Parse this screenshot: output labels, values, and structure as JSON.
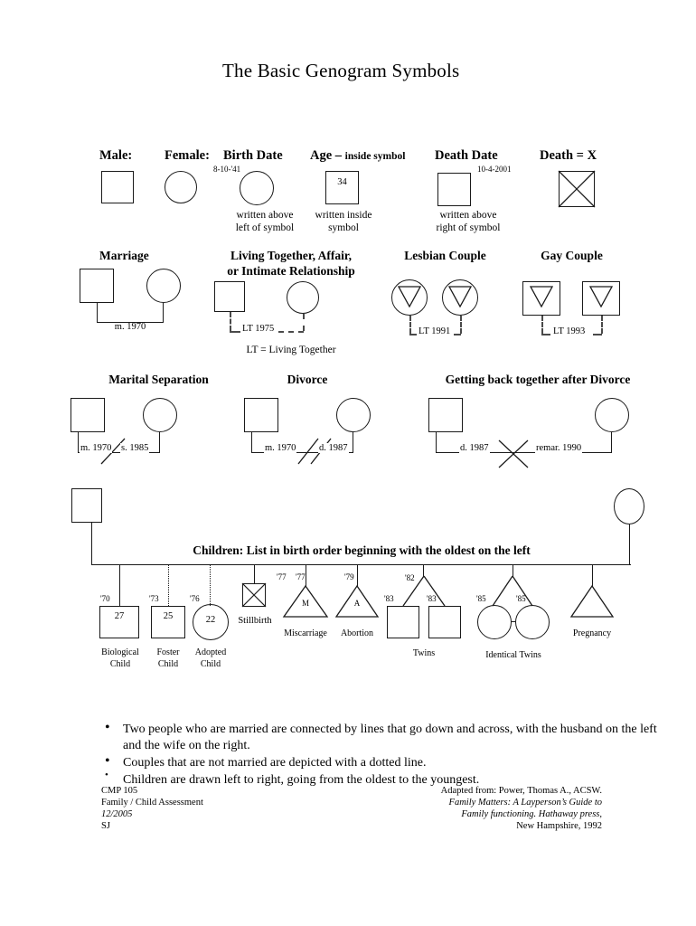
{
  "title": "The Basic Genogram Symbols",
  "row1": {
    "male": {
      "heading": "Male:",
      "icon": "square-symbol"
    },
    "female": {
      "heading": "Female:",
      "icon": "circle-symbol"
    },
    "birth_date": {
      "heading": "Birth Date",
      "value": "8-10-'41",
      "note_line1": "written above",
      "note_line2": "left of symbol"
    },
    "age": {
      "heading": "Age – inside symbol",
      "heading_main": "Age – ",
      "heading_small": "inside symbol",
      "value": "34",
      "note_line1": "written inside",
      "note_line2": "symbol"
    },
    "death_date": {
      "heading": "Death Date",
      "value": "10-4-2001",
      "note_line1": "written above",
      "note_line2": "right of symbol"
    },
    "death_x": {
      "heading": "Death = X",
      "icon": "x-square-symbol"
    }
  },
  "row2": {
    "marriage": {
      "heading": "Marriage",
      "label": "m. 1970"
    },
    "living_together": {
      "heading_line1": "Living Together, Affair,",
      "heading_line2": "or Intimate Relationship",
      "label": "LT 1975",
      "legend": "LT = Living Together"
    },
    "lesbian": {
      "heading": "Lesbian Couple",
      "label": "LT 1991"
    },
    "gay": {
      "heading": "Gay Couple",
      "label": "LT 1993"
    }
  },
  "row3": {
    "separation": {
      "heading": "Marital Separation",
      "label_left": "m. 1970",
      "label_right": "s. 1985"
    },
    "divorce": {
      "heading": "Divorce",
      "label_left": "m. 1970",
      "label_right": "d. 1987"
    },
    "reunion": {
      "heading": "Getting back together after Divorce",
      "label_left": "d. 1987",
      "label_right": "remar. 1990"
    }
  },
  "children": {
    "heading": "Children:  List in birth order beginning with the oldest on the left",
    "items": [
      {
        "name": "biological-child",
        "year": "'70",
        "inner": "27",
        "caption_line1": "Biological",
        "caption_line2": "Child",
        "shape": "square",
        "line": "solid"
      },
      {
        "name": "foster-child",
        "year": "'73",
        "inner": "25",
        "caption_line1": "Foster",
        "caption_line2": "Child",
        "shape": "square",
        "line": "dotted"
      },
      {
        "name": "adopted-child",
        "year": "'76",
        "inner": "22",
        "caption_line1": "Adopted",
        "caption_line2": "Child",
        "shape": "circle",
        "line": "dotted"
      },
      {
        "name": "stillbirth",
        "year": "",
        "inner": "",
        "caption_line1": "Stillbirth",
        "caption_line2": "",
        "shape": "x-square",
        "line": "solid"
      },
      {
        "name": "miscarriage",
        "year": "'77",
        "year2": "'77",
        "inner": "M",
        "caption_line1": "Miscarriage",
        "caption_line2": "",
        "shape": "triangle",
        "line": "solid"
      },
      {
        "name": "abortion",
        "year": "'79",
        "inner": "A",
        "caption_line1": "Abortion",
        "caption_line2": "",
        "shape": "triangle",
        "line": "solid"
      },
      {
        "name": "twins",
        "year": "'82",
        "year_left": "'83",
        "year_right": "'83",
        "caption_line1": "Twins",
        "caption_line2": "",
        "shape": "twin-squares",
        "line": "solid"
      },
      {
        "name": "identical-twins",
        "year_left": "'85",
        "year_right": "'85",
        "caption_line1": "Identical Twins",
        "caption_line2": "",
        "shape": "twin-circles",
        "line": "solid"
      },
      {
        "name": "pregnancy",
        "year": "",
        "inner": "",
        "caption_line1": "Pregnancy",
        "caption_line2": "",
        "shape": "triangle",
        "line": "solid"
      }
    ]
  },
  "bullets": [
    "Two people who are married are connected by lines that go down and across, with the husband on the left and the wife on the right.",
    "Couples that are not married are depicted with a dotted line.",
    "Children are drawn left to right, going from the oldest to the youngest."
  ],
  "footer": {
    "left": [
      "CMP 105",
      "Family / Child Assessment",
      "12/2005",
      "SJ"
    ],
    "right": [
      "Adapted from:  Power, Thomas A., ACSW.",
      "Family Matters:  A Layperson’s Guide to",
      "Family functioning.  Hathaway press,",
      "New Hampshire, 1992"
    ]
  }
}
